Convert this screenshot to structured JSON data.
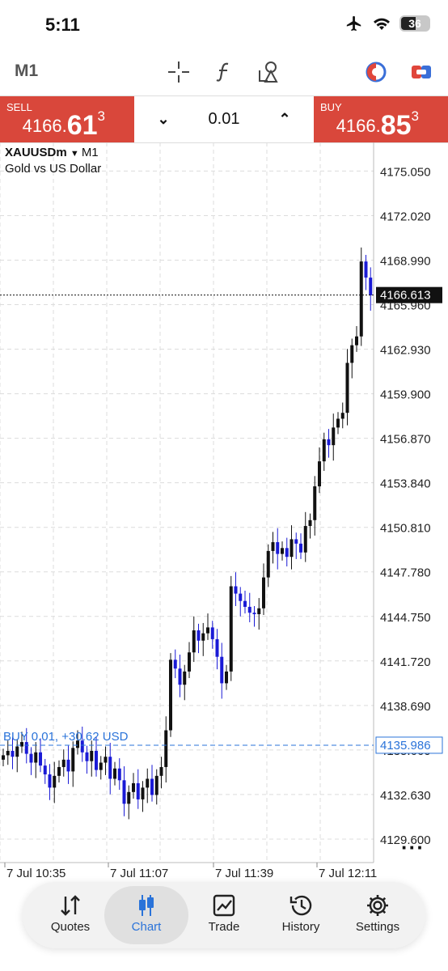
{
  "status": {
    "time": "5:11",
    "battery": "36"
  },
  "toolbar": {
    "timeframe": "M1",
    "tools": [
      "crosshair-icon",
      "function-icon",
      "objects-icon",
      "indicator-icon",
      "one-click-trading-icon"
    ]
  },
  "trade": {
    "sell": {
      "label": "SELL",
      "price_prefix": "4166.",
      "price_big": "61",
      "price_sup": "3"
    },
    "buy": {
      "label": "BUY",
      "price_prefix": "4166.",
      "price_big": "85",
      "price_sup": "3"
    },
    "lot": "0.01"
  },
  "symbol": {
    "name": "XAUUSDm",
    "timeframe": "M1",
    "description": "Gold vs US Dollar"
  },
  "chart_data": {
    "type": "candlestick",
    "y_ticks": [
      "4175.050",
      "4172.020",
      "4168.990",
      "4165.960",
      "4162.930",
      "4159.900",
      "4156.870",
      "4153.840",
      "4150.810",
      "4147.780",
      "4144.750",
      "4141.720",
      "4138.690",
      "4135.660",
      "4132.630",
      "4129.600"
    ],
    "x_ticks": [
      "7 Jul 10:35",
      "7 Jul 11:07",
      "7 Jul 11:39",
      "7 Jul 12:11"
    ],
    "ylim": [
      4128.0,
      4177.0
    ],
    "current_price": "4166.613",
    "position": {
      "label": "BUY 0.01, +30.62 USD",
      "price": "4135.986"
    },
    "closes": [
      4135.3,
      4135.6,
      4135.2,
      4135.9,
      4136.2,
      4135.4,
      4134.8,
      4135.5,
      4134.6,
      4134.0,
      4133.1,
      4133.9,
      4134.5,
      4135.0,
      4134.2,
      4135.8,
      4136.3,
      4135.5,
      4134.9,
      4135.6,
      4134.3,
      4134.8,
      4135.2,
      4133.7,
      4134.4,
      4133.6,
      4132.0,
      4132.8,
      4133.4,
      4132.3,
      4133.1,
      4133.7,
      4132.6,
      4133.9,
      4134.5,
      4137.0,
      4141.8,
      4141.2,
      4140.1,
      4141.0,
      4142.3,
      4143.8,
      4143.1,
      4143.6,
      4144.0,
      4143.2,
      4142.0,
      4140.2,
      4141.0,
      4146.8,
      4146.3,
      4145.8,
      4145.4,
      4145.0,
      4144.9,
      4145.3,
      4147.4,
      4149.2,
      4149.8,
      4149.0,
      4149.4,
      4148.8,
      4150.0,
      4149.7,
      4149.1,
      4150.9,
      4151.3,
      4153.6,
      4155.3,
      4156.8,
      4156.4,
      4157.6,
      4158.2,
      4158.6,
      4162.0,
      4163.2,
      4163.8,
      4168.9,
      4167.8,
      4166.6
    ],
    "xlabel": "",
    "ylabel": ""
  },
  "nav": {
    "items": [
      {
        "label": "Quotes",
        "icon": "quotes-arrows-icon"
      },
      {
        "label": "Chart",
        "icon": "chart-candles-icon"
      },
      {
        "label": "Trade",
        "icon": "trade-chart-icon"
      },
      {
        "label": "History",
        "icon": "history-clock-icon"
      },
      {
        "label": "Settings",
        "icon": "settings-gear-icon"
      }
    ],
    "active": "Chart"
  },
  "colors": {
    "sell": "#d9473b",
    "buy": "#d9473b",
    "bull": "#111111",
    "bear": "#1a1ad6",
    "position": "#2a73d9",
    "accent": "#2a73d9"
  }
}
